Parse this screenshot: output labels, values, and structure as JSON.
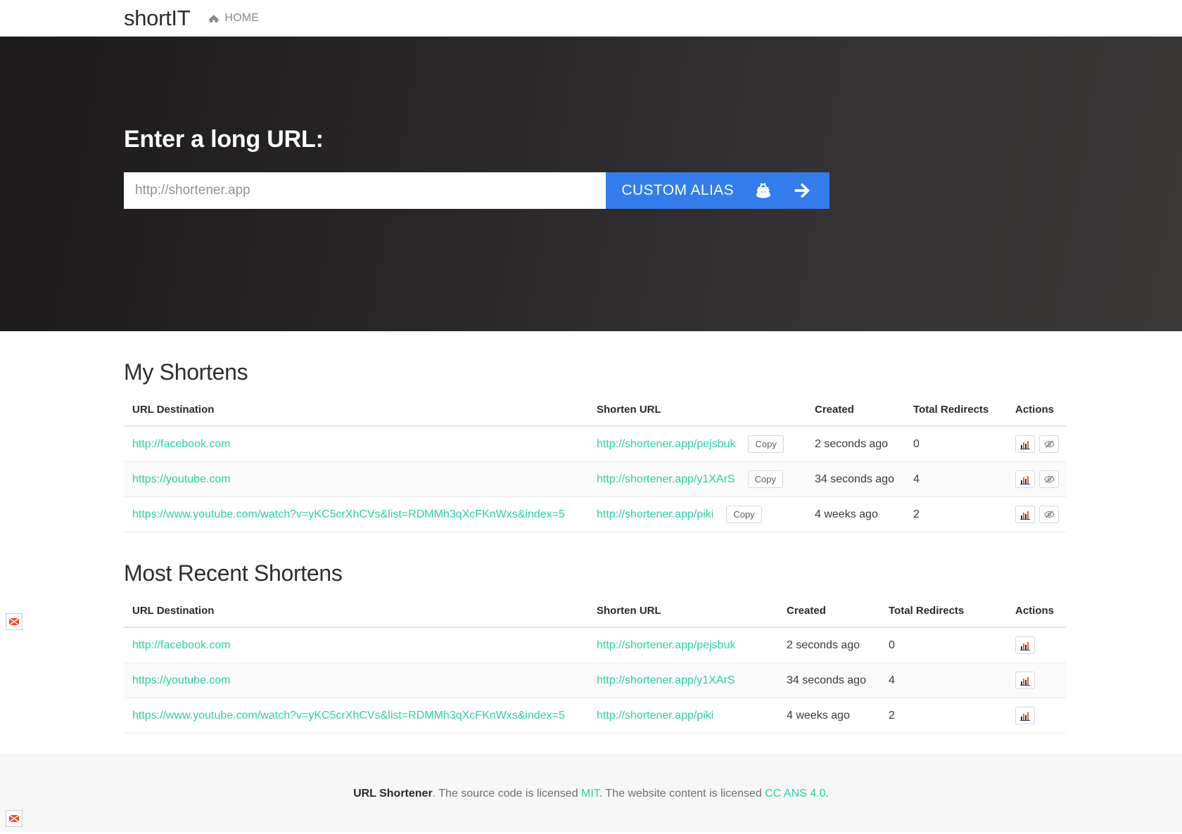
{
  "navbar": {
    "brand": "shortIT",
    "home_label": "HOME",
    "home_icon": "home-icon"
  },
  "hero": {
    "title": "Enter a long URL:",
    "input_placeholder": "http://shortener.app",
    "input_value": "",
    "custom_alias_label": "CUSTOM ALIAS",
    "alias_icon": "user-secret-icon",
    "submit_icon": "arrow-right-icon",
    "accent_color": "#337ceb"
  },
  "my_shortens": {
    "title": "My Shortens",
    "columns": [
      "URL Destination",
      "Shorten URL",
      "Created",
      "Total Redirects",
      "Actions"
    ],
    "copy_label": "Copy",
    "rows": [
      {
        "destination": "http://facebook.com",
        "shorten": "http://shortener.app/pejsbuk",
        "created": "2 seconds ago",
        "redirects": "0"
      },
      {
        "destination": "https://youtube.com",
        "shorten": "http://shortener.app/y1XArS",
        "created": "34 seconds ago",
        "redirects": "4"
      },
      {
        "destination": "https://www.youtube.com/watch?v=yKC5crXhCVs&list=RDMMh3qXcFKnWxs&index=5",
        "shorten": "http://shortener.app/piki",
        "created": "4 weeks ago",
        "redirects": "2"
      }
    ],
    "action_icons": [
      "chart-bar-icon",
      "eye-slash-icon"
    ]
  },
  "recent_shortens": {
    "title": "Most Recent Shortens",
    "columns": [
      "URL Destination",
      "Shorten URL",
      "Created",
      "Total Redirects",
      "Actions"
    ],
    "rows": [
      {
        "destination": "http://facebook.com",
        "shorten": "http://shortener.app/pejsbuk",
        "created": "2 seconds ago",
        "redirects": "0"
      },
      {
        "destination": "https://youtube.com",
        "shorten": "http://shortener.app/y1XArS",
        "created": "34 seconds ago",
        "redirects": "4"
      },
      {
        "destination": "https://www.youtube.com/watch?v=yKC5crXhCVs&list=RDMMh3qXcFKnWxs&index=5",
        "shorten": "http://shortener.app/piki",
        "created": "4 weeks ago",
        "redirects": "2"
      }
    ],
    "action_icons": [
      "chart-bar-icon"
    ]
  },
  "footer": {
    "brand": "URL Shortener",
    "text_1": ". The source code is licensed ",
    "link_1": "MIT",
    "text_2": ". The website content is licensed ",
    "link_2": "CC ANS 4.0",
    "text_3": ".",
    "link_color": "#2bd1a4"
  }
}
